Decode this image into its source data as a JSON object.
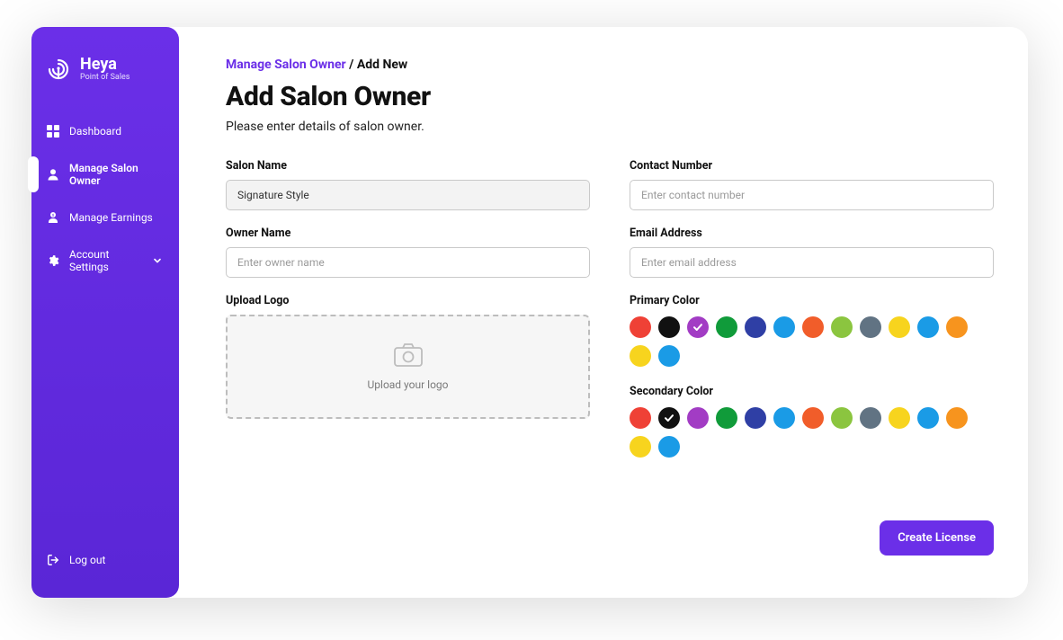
{
  "brand": {
    "name": "Heya",
    "subtitle": "Point of Sales"
  },
  "nav": {
    "dashboard": "Dashboard",
    "manage_salon_owner": "Manage Salon Owner",
    "manage_earnings": "Manage Earnings",
    "account_settings": "Account Settings"
  },
  "logout": "Log out",
  "breadcrumb": {
    "parent": "Manage Salon Owner",
    "separator": " / ",
    "current": "Add New"
  },
  "page": {
    "title": "Add Salon Owner",
    "subtitle": "Please enter details of salon owner."
  },
  "form": {
    "salon_name": {
      "label": "Salon Name",
      "value": "Signature Style",
      "placeholder": ""
    },
    "contact_number": {
      "label": "Contact Number",
      "value": "",
      "placeholder": "Enter contact number"
    },
    "owner_name": {
      "label": "Owner Name",
      "value": "",
      "placeholder": "Enter owner name"
    },
    "email": {
      "label": "Email Address",
      "value": "",
      "placeholder": "Enter email address"
    },
    "upload": {
      "label": "Upload Logo",
      "hint": "Upload your logo"
    }
  },
  "colors": {
    "primary_label": "Primary Color",
    "secondary_label": "Secondary Color",
    "swatches": [
      "#ef4136",
      "#111111",
      "#a23cc4",
      "#109b3a",
      "#2f3fa5",
      "#1a9be6",
      "#f15d2a",
      "#8bc53f",
      "#617383",
      "#f7d41e",
      "#1a9be6",
      "#f7941e",
      "#f7d41e",
      "#1a9be6"
    ],
    "primary_selected_index": 2,
    "secondary_selected_index": 1
  },
  "actions": {
    "create": "Create License"
  }
}
